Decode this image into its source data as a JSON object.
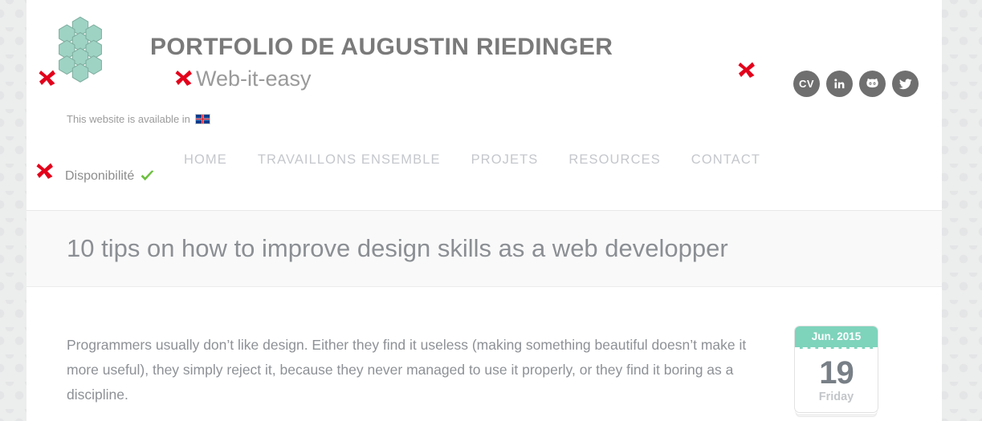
{
  "colors": {
    "accent_mint": "#7ed3bb",
    "brand_gray": "#7a7a7a",
    "nav_gray": "#c4c7cc",
    "text_gray": "#8d9196",
    "social_circle": "#6f6f6f",
    "annotation_red": "#e3001b",
    "check_green": "#6cbf3f",
    "page_bg": "#ffffff",
    "texture_bg": "#eceded",
    "title_band_bg": "#f9f9f9"
  },
  "header": {
    "logo_icon": "honeycomb-hexagons-logo",
    "brand_title": "PORTFOLIO DE AUGUSTIN RIEDINGER",
    "brand_subtitle": "Web-it-easy",
    "language_text": "This website is available in",
    "language_flag_icon": "uk-flag-icon",
    "availability_label": "Disponibilité",
    "availability_icon": "green-check-icon"
  },
  "social": [
    {
      "name": "cv-link",
      "label": "CV",
      "icon": "cv-text-icon"
    },
    {
      "name": "linkedin-link",
      "label": "",
      "icon": "linkedin-icon"
    },
    {
      "name": "github-link",
      "label": "",
      "icon": "github-octocat-icon"
    },
    {
      "name": "twitter-link",
      "label": "",
      "icon": "twitter-bird-icon"
    }
  ],
  "nav": {
    "items": [
      {
        "label": "HOME"
      },
      {
        "label": "TRAVAILLONS ENSEMBLE"
      },
      {
        "label": "PROJETS"
      },
      {
        "label": "RESOURCES"
      },
      {
        "label": "CONTACT"
      }
    ]
  },
  "article": {
    "title": "10 tips on how to improve design skills as a web developper",
    "paragraph": "Programmers usually don’t like design. Either they find it useless (making something beautiful doesn’t make it more useful), they simply reject it, because they never managed to use it properly, or they find it boring as a discipline."
  },
  "date_badge": {
    "month": "Jun. 2015",
    "day": "19",
    "weekday": "Friday"
  },
  "annotations": [
    {
      "name": "x-mark-logo",
      "icon": "red-x-icon"
    },
    {
      "name": "x-mark-subtitle",
      "icon": "red-x-icon"
    },
    {
      "name": "x-mark-social",
      "icon": "red-x-icon"
    },
    {
      "name": "x-mark-availability",
      "icon": "red-x-icon"
    }
  ]
}
